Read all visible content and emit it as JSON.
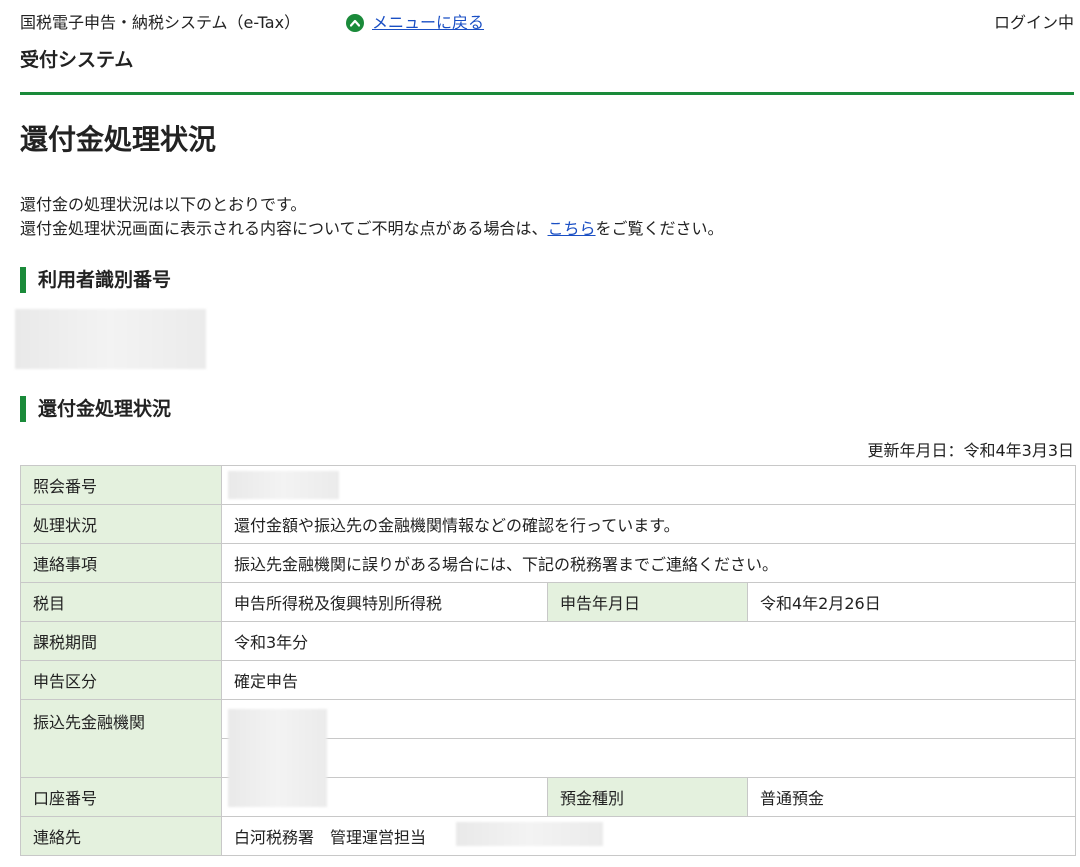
{
  "header": {
    "system_name": "国税電子申告・納税システム（e-Tax）",
    "menu_link": "メニューに戻る",
    "login_status": "ログイン中",
    "subsystem": "受付システム"
  },
  "page": {
    "title": "還付金処理状況",
    "intro_line1": "還付金の処理状況は以下のとおりです。",
    "intro_line2_before": "還付金処理状況画面に表示される内容についてご不明な点がある場合は、",
    "intro_link": "こちら",
    "intro_line2_after": "をご覧ください。"
  },
  "sections": {
    "user_id": "利用者識別番号",
    "refund_status": "還付金処理状況"
  },
  "updated": "更新年月日：令和4年3月3日",
  "table": {
    "inquiry_no": {
      "label": "照会番号"
    },
    "processing": {
      "label": "処理状況",
      "value": "還付金額や振込先の金融機関情報などの確認を行っています。"
    },
    "contact_note": {
      "label": "連絡事項",
      "value": "振込先金融機関に誤りがある場合には、下記の税務署までご連絡ください。"
    },
    "tax_item": {
      "label": "税目",
      "value": "申告所得税及復興特別所得税",
      "label2": "申告年月日",
      "value2": "令和4年2月26日"
    },
    "period": {
      "label": "課税期間",
      "value": "令和3年分"
    },
    "filing_type": {
      "label": "申告区分",
      "value": "確定申告"
    },
    "bank": {
      "label": "振込先金融機関"
    },
    "account": {
      "label": "口座番号",
      "label2": "預金種別",
      "value2": "普通預金"
    },
    "contact": {
      "label": "連絡先",
      "value": "白河税務署　管理運営担当"
    }
  }
}
